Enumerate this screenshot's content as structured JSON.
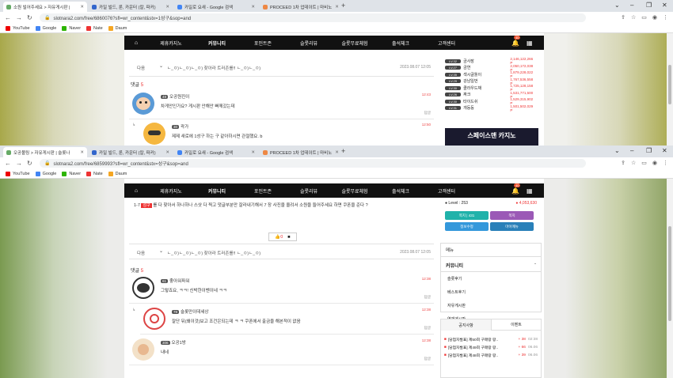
{
  "win1": {
    "tabs": [
      {
        "title": "소원 빌어주세요 > 자유게시판 | ",
        "color": "#6a6"
      },
      {
        "title": "카일 빌드, 룬, 카운터 (칼, 파커) ",
        "color": "#36c"
      },
      {
        "title": "카일로 요새 - Google 검색",
        "color": "#4285f4"
      },
      {
        "title": "PROCEED 1차 업데이트 | 마비노",
        "color": "#e84"
      }
    ],
    "url": "slotnara2.com/free/6860076?sfl=wr_content&stx=1성구&sop=and",
    "post_footer": {
      "list": "다음",
      "emote": "ㄴ_ㅇ)ㄴ_ㅇ)ㄴ_ㅇ) 찾아라 트러존를!! ㄴ_ㅇ)ㄴ_ㅇ)",
      "date": "2023.08.07 12:05"
    },
    "comments_label": "댓글",
    "comments_count": "5",
    "comments": [
      {
        "level": "49",
        "nick": "오공원진이",
        "text": "차게안인가요? 게시판 안해안 뻐께갔는데",
        "time": "12:43",
        "reply": "답글"
      },
      {
        "level": "30",
        "nick": "곽가",
        "text": "제제 새로에 1성구 하는 구 같아하시면 관절했요. b",
        "time": "12:50",
        "reply": ""
      }
    ],
    "ranking": [
      {
        "lv": "LV.32",
        "name": "금사장",
        "pts": "2,146,122,266 P"
      },
      {
        "lv": "LV.27",
        "name": "금연",
        "pts": "2,050,172,038 P"
      },
      {
        "lv": "LV.35",
        "name": "섹시글톨이",
        "pts": "1,879,228,022 P"
      },
      {
        "lv": "LV.29",
        "name": "강남일번",
        "pts": "1,767,536,558 P"
      },
      {
        "lv": "LV.30",
        "name": "클라우드채",
        "pts": "1,725,128,158 P"
      },
      {
        "lv": "LV.26",
        "name": "짜크",
        "pts": "1,531,771,500 P"
      },
      {
        "lv": "LV.30",
        "name": "타이드쉬",
        "pts": "1,529,315,902 P"
      },
      {
        "lv": "LV.31",
        "name": "개둥둥",
        "pts": "1,501,502,029 P"
      }
    ],
    "banner": "스페이스맨 카지노"
  },
  "win2": {
    "tabs": [
      {
        "title": "오공볼링 > 자유게시판 | 슬롯나",
        "color": "#6a6"
      },
      {
        "title": "카일 빌드, 룬, 카운터 (칼, 파커) ",
        "color": "#36c"
      },
      {
        "title": "카일로 요새 - Google 검색",
        "color": "#4285f4"
      },
      {
        "title": "PROCEED 1차 업데이트 | 마비노",
        "color": "#e84"
      }
    ],
    "url": "slotnara2.com/free/6859993?sfl=wr_content&stx=성구&sop=and",
    "post_text_a": "1-7 ",
    "post_tag": "성구",
    "post_text_b": "를 다 찾아서 하나하나 스샷 다 찍고 댓글부분만 잘라내기해서 7 장 사진을 올려서 소원을 들어주세요 하면   쿠폰을 준다 ?",
    "like": "0",
    "post_footer": {
      "list": "다음",
      "emote": "ㄴ_ㅇ)ㄴ_ㅇ)ㄴ_ㅇ) 찾아라 트러존를!! ㄴ_ㅇ)ㄴ_ㅇ)",
      "date": "2023.08.07 12:05"
    },
    "comments_label": "댓글",
    "comments_count": "5",
    "comments": [
      {
        "level": "61",
        "nick": "좋아워파워",
        "text": "그렇죠요, ㅋㅋ! 신박한이벤이네 ㅋㅋ",
        "time": "12:38",
        "reply": "답글"
      },
      {
        "level": "78",
        "nick": "슬롯만이데세상",
        "text": "잘단 뒤(왜이것)보고 조건은되는데 ㅋ ㅋ 쿠폰에서 출금을 해본적이 없음",
        "time": "12:38",
        "reply": "답글"
      },
      {
        "level": "306",
        "nick": "오공1방",
        "text": "내네",
        "time": "12:38",
        "reply": "답글"
      }
    ],
    "profile": {
      "level": "Level : 253",
      "points": "4,053,630"
    },
    "buttons": [
      "쪽지 | 431",
      "쪽지",
      "정보수정",
      "마이메뉴"
    ],
    "menu_title": "메뉴",
    "menu_head": "커뮤니티",
    "menu_items": [
      "슬롯후기",
      "베스트후기",
      "자유게시판",
      "연재게시판"
    ],
    "notice_tabs": [
      "공지사항",
      "이벤트"
    ],
    "notices": [
      {
        "title": "[당첨자발표] 제50회 구매랑 랑..",
        "cnt": "+ 38",
        "time": "02:38"
      },
      {
        "title": "[당첨자발표] 제49회 구매랑 랑..",
        "cnt": "+ 66",
        "time": "06.06"
      },
      {
        "title": "[당첨자발표] 제48회 구매랑 랑..",
        "cnt": "+ 39",
        "time": "06.06"
      }
    ]
  },
  "menu": [
    "제휴카지노",
    "커뮤니티",
    "포인트존",
    "슬롯리뷰",
    "슬롯무료체험",
    "출석체크",
    "고객센터"
  ],
  "notif_count": "40",
  "bookmarks": [
    "YouTube",
    "Google",
    "Naver",
    "Nate",
    "Daum"
  ]
}
